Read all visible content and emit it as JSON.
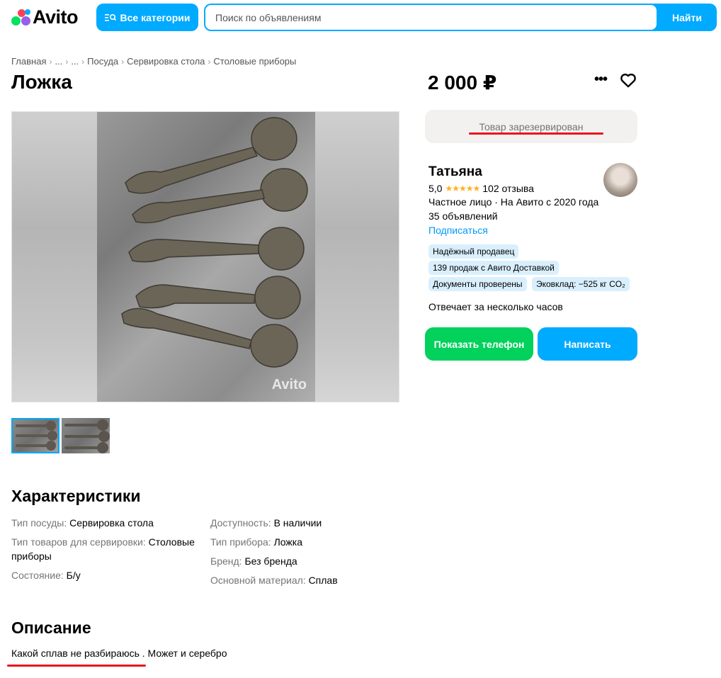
{
  "header": {
    "logo_text": "Avito",
    "categories_label": "Все категории",
    "search_placeholder": "Поиск по объявлениям",
    "search_button": "Найти"
  },
  "breadcrumb": [
    "Главная",
    "...",
    "...",
    "Посуда",
    "Сервировка стола",
    "Столовые приборы"
  ],
  "listing": {
    "title": "Ложка",
    "price": "2 000 ₽",
    "reserved_text": "Товар зарезервирован",
    "watermark": "Avito"
  },
  "seller": {
    "name": "Татьяна",
    "rating": "5,0",
    "stars": "★★★★★",
    "reviews": "102 отзыва",
    "type": "Частное лицо · На Авито с 2020 года",
    "ads": "35 объявлений",
    "subscribe": "Подписаться",
    "badges": [
      "Надёжный продавец",
      "139 продаж с Авито Доставкой",
      "Документы проверены",
      "Эковклад: −525 кг CO₂"
    ],
    "reply_time": "Отвечает за несколько часов",
    "phone_button": "Показать телефон",
    "write_button": "Написать"
  },
  "specs": {
    "title": "Характеристики",
    "left": [
      {
        "k": "Тип посуды: ",
        "v": "Сервировка стола"
      },
      {
        "k": "Тип товаров для сервировки: ",
        "v": "Столовые приборы"
      },
      {
        "k": "Состояние: ",
        "v": "Б/у"
      }
    ],
    "right": [
      {
        "k": "Доступность: ",
        "v": "В наличии"
      },
      {
        "k": "Тип прибора: ",
        "v": "Ложка"
      },
      {
        "k": "Бренд: ",
        "v": "Без бренда"
      },
      {
        "k": "Основной материал: ",
        "v": "Сплав"
      }
    ]
  },
  "description": {
    "title": "Описание",
    "text": "Какой сплав не разбираюсь . Может и серебро"
  },
  "colors": {
    "accent": "#00aaff",
    "green": "#02d15c",
    "red_mark": "#e8141e"
  }
}
